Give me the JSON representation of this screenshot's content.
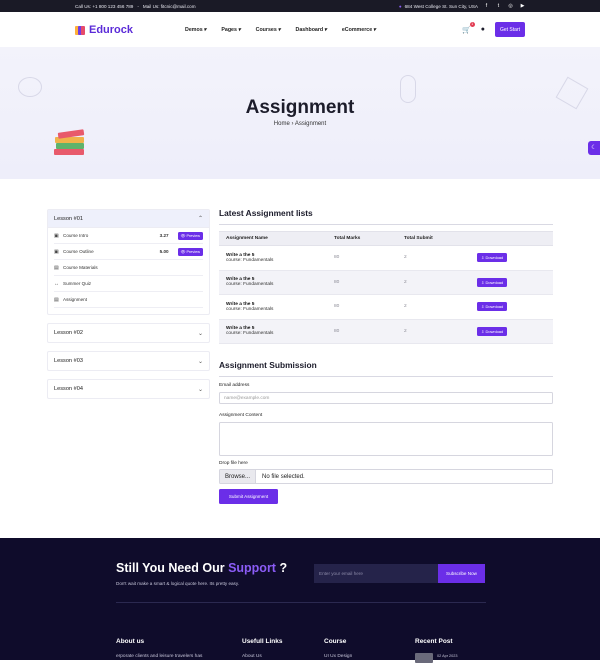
{
  "topbar": {
    "call": "Call Us: +1 800 123 456 789",
    "mail": "Mail Us: fitcnic@mail.com",
    "address": "684 West College St. Sun City, USA"
  },
  "header": {
    "logo": "Edurock",
    "nav": [
      "Demos",
      "Pages",
      "Courses",
      "Dashboard",
      "eCommerce"
    ],
    "cart_count": "1",
    "get_start": "Get Start"
  },
  "hero": {
    "title": "Assignment",
    "breadcrumb_home": "Home",
    "breadcrumb_current": "Assignment"
  },
  "sidebar": {
    "lesson1": "Lesson #01",
    "items": [
      {
        "label": "Course Intro",
        "duration": "3.27",
        "preview": "Preview",
        "icon": "video-icon"
      },
      {
        "label": "Course Outline",
        "duration": "5.00",
        "preview": "Preview",
        "icon": "video-icon"
      },
      {
        "label": "Course Materials",
        "icon": "file-icon"
      },
      {
        "label": "Summer Quiz",
        "icon": "quiz-icon"
      },
      {
        "label": "Assignment",
        "icon": "file-icon"
      }
    ],
    "lesson2": "Lesson #02",
    "lesson3": "Lesson #03",
    "lesson4": "Lesson #04"
  },
  "assignments": {
    "title": "Latest Assignment lists",
    "columns": [
      "Assignment Name",
      "Total Marks",
      "Total Submit"
    ],
    "rows": [
      {
        "name": "Write a the 5",
        "course": "course: Fundamentals",
        "marks": "80",
        "submit": "2",
        "action": "Download"
      },
      {
        "name": "Write a the 5",
        "course": "course: Fundamentals",
        "marks": "80",
        "submit": "2",
        "action": "Download"
      },
      {
        "name": "Write a the 5",
        "course": "course: Fundamentals",
        "marks": "80",
        "submit": "2",
        "action": "Download"
      },
      {
        "name": "Write a the 5",
        "course": "course: Fundamentals",
        "marks": "80",
        "submit": "2",
        "action": "Download"
      }
    ]
  },
  "submission": {
    "title": "Assignment Submission",
    "email_label": "Email address",
    "email_placeholder": "name@example.com",
    "content_label": "Assignment Content",
    "file_label": "Drop file here",
    "browse": "Browse...",
    "no_file": "No file selected.",
    "submit": "Submit Assignment"
  },
  "footer": {
    "cta_prefix": "Still You Need Our ",
    "cta_highlight": "Support",
    "cta_suffix": " ?",
    "cta_sub": "Don't wait make a smart & logical quote here. Its pretty easy.",
    "email_placeholder": "Enter your email here",
    "subscribe": "Subscribe Now",
    "about_title": "About us",
    "about_text": "erporate clients and leisure travelers has",
    "links_title": "Usefull Links",
    "links_first": "About Us",
    "course_title": "Course",
    "course_first": "UI Ux Design",
    "recent_title": "Recent Post",
    "recent_date": "02 Apr 2023"
  }
}
